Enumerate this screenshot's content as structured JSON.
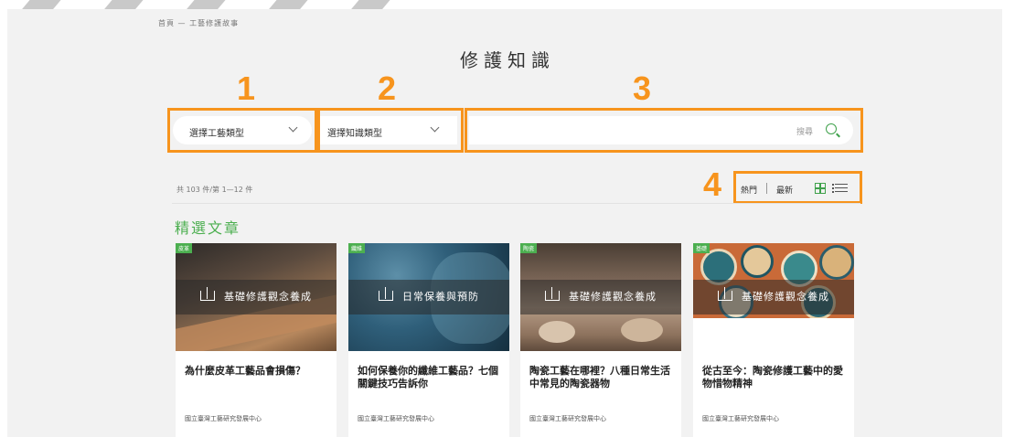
{
  "breadcrumb": "首頁 — 工藝修護故事",
  "page_title": "修護知識",
  "annotations": [
    "1",
    "2",
    "3",
    "4"
  ],
  "filters": {
    "craft_type": "選擇工藝類型",
    "knowledge_type": "選擇知識類型"
  },
  "search": {
    "placeholder": "搜尋"
  },
  "result_count": "共 103 件/第 1—12 件",
  "sort": {
    "popular": "熱門",
    "latest": "最新"
  },
  "icons": {
    "view_grid": "grid-icon",
    "view_list": "list-icon",
    "search": "search-icon"
  },
  "colors": {
    "accent": "#4caf50",
    "annotation": "#f7941d"
  },
  "section_title": "精選文章",
  "cards": [
    {
      "tag": "皮革",
      "category": "基礎修護觀念養成",
      "title": "為什麼皮革工藝品會損傷？",
      "author": "國立臺灣工藝研究發展中心"
    },
    {
      "tag": "纖維",
      "category": "日常保養與預防",
      "title": "如何保養你的纖維工藝品？七個關鍵技巧告訴你",
      "author": "國立臺灣工藝研究發展中心"
    },
    {
      "tag": "陶瓷",
      "category": "基礎修護觀念養成",
      "title": "陶瓷工藝在哪裡？八種日常生活中常見的陶瓷器物",
      "author": "國立臺灣工藝研究發展中心"
    },
    {
      "tag": "基礎",
      "category": "基礎修護觀念養成",
      "title": "從古至今：陶瓷修護工藝中的愛物惜物精神",
      "author": "國立臺灣工藝研究發展中心"
    }
  ]
}
